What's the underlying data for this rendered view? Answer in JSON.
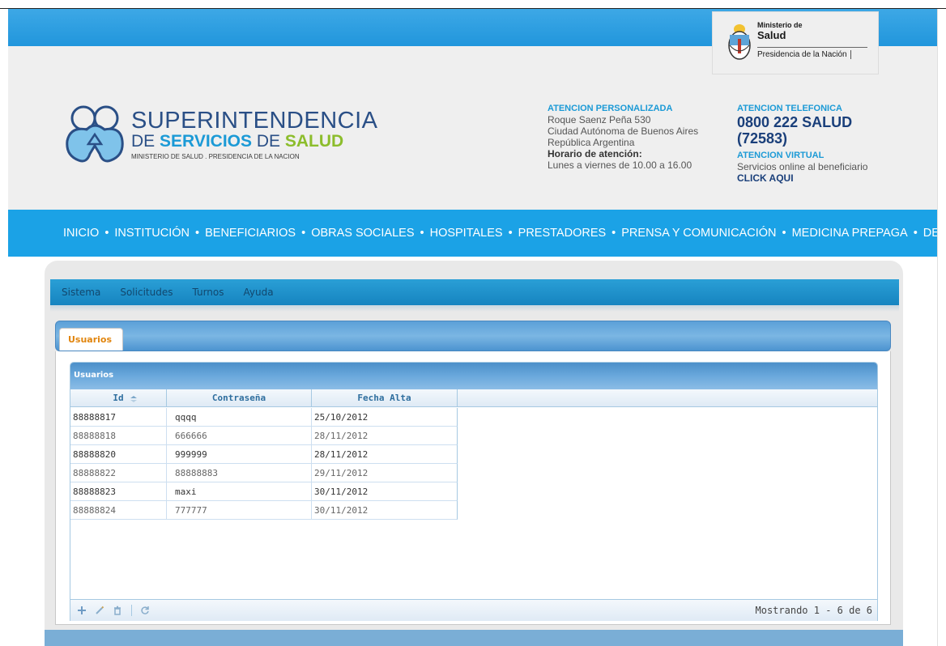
{
  "ministerio": {
    "line1": "Ministerio de",
    "line2": "Salud",
    "line3": "Presidencia de la Nación"
  },
  "logo": {
    "line1": "SUPERINTENDENCIA",
    "de": "DE ",
    "servicios": "SERVICIOS",
    "de2": " DE ",
    "salud": "SALUD",
    "subtitle": "MINISTERIO DE SALUD . PRESIDENCIA DE LA NACION"
  },
  "contact": {
    "personal_title": "ATENCION PERSONALIZADA",
    "address1": "Roque Saenz Peña 530",
    "address2": "Ciudad Autónoma de Buenos Aires",
    "address3": "República Argentina",
    "hours_label": "Horario de atención:",
    "hours": "Lunes a viernes de 10.00 a 16.00",
    "phone_title": "ATENCION TELEFONICA",
    "phone": "0800 222 SALUD (72583)",
    "virtual_title": "ATENCION VIRTUAL",
    "virtual_text": "Servicios online al beneficiario",
    "click": "CLICK AQUI"
  },
  "main_nav": [
    "INICIO",
    "INSTITUCIÓN",
    "BENEFICIARIOS",
    "OBRAS SOCIALES",
    "HOSPITALES",
    "PRESTADORES",
    "PRENSA Y COMUNICACIÓN",
    "MEDICINA PREPAGA",
    "DELEGACIONES"
  ],
  "nav_separator": "•",
  "app_menu": [
    "Sistema",
    "Solicitudes",
    "Turnos",
    "Ayuda"
  ],
  "tab": {
    "label": "Usuarios"
  },
  "grid": {
    "caption": "Usuarios",
    "columns": [
      "Id",
      "Contraseña",
      "Fecha Alta"
    ],
    "rows": [
      [
        "88888817",
        "qqqq",
        "25/10/2012"
      ],
      [
        "88888818",
        "666666",
        "28/11/2012"
      ],
      [
        "88888820",
        "999999",
        "28/11/2012"
      ],
      [
        "88888822",
        "88888883",
        "29/11/2012"
      ],
      [
        "88888823",
        "maxi",
        "30/11/2012"
      ],
      [
        "88888824",
        "777777",
        "30/11/2012"
      ]
    ],
    "pager_info": "Mostrando 1 - 6 de 6",
    "pager_icons": [
      "add-icon",
      "edit-icon",
      "delete-icon",
      "refresh-icon"
    ]
  },
  "colors": {
    "brand_blue": "#1ba2e6",
    "dark_blue": "#2a4f86",
    "green": "#8cbd2c",
    "tab_orange": "#e1850e"
  }
}
